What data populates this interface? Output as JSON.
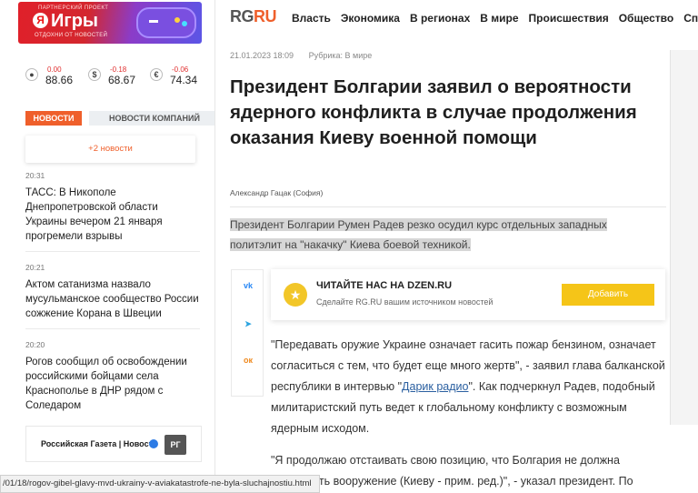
{
  "promo": {
    "tag": "ПАРТНЕРСКИЙ ПРОЕКТ",
    "ya": "Я",
    "title": "Игры",
    "subtitle": "ОТДОХНИ ОТ НОВОСТЕЙ"
  },
  "rates": [
    {
      "icon": "oil-drop-icon",
      "glyph": "●",
      "delta": "0.00",
      "value": "88.66"
    },
    {
      "icon": "dollar-icon",
      "glyph": "$",
      "delta": "-0.18",
      "value": "68.67"
    },
    {
      "icon": "euro-icon",
      "glyph": "€",
      "delta": "-0.06",
      "value": "74.34"
    }
  ],
  "tabs": {
    "active": "НОВОСТИ",
    "other": "НОВОСТИ КОМПАНИЙ"
  },
  "more_news": "+2 новости",
  "news": [
    {
      "time": "20:31",
      "title": "ТАСС: В Никополе Днепропетровской области Украины вечером 21 января прогремели взрывы"
    },
    {
      "time": "20:21",
      "title": "Актом сатанизма назвало мусульманское сообщество России сожжение Корана в Швеции"
    },
    {
      "time": "20:20",
      "title": "Рогов сообщил об освобождении российскими бойцами села Краснополье в ДНР рядом с Соледаром"
    }
  ],
  "rg_banner": {
    "text": "Российская Газета | Новости",
    "logo": "РГ"
  },
  "header": {
    "logo_rg": "RG",
    "logo_ru": "RU",
    "nav": [
      "Власть",
      "Экономика",
      "В регионах",
      "В мире",
      "Происшествия",
      "Общество",
      "Спорт"
    ]
  },
  "article": {
    "date": "21.01.2023 18:09",
    "rubric": "Рубрика: В мире",
    "headline": "Президент Болгарии заявил о вероятности ядерного конфликта в случае продолжения оказания Киеву военной помощи",
    "author": "Александр Гацак (София)",
    "lead": "Президент Болгарии Румен Радев резко осудил курс отдельных западных политэлит на \"накачку\" Киева боевой техникой.",
    "para1_a": "\"Передавать оружие Украине означает гасить пожар бензином, означает согласиться с тем, что будет еще много жертв\", - заявил глава балканской республики в интервью \"",
    "para1_link": "Дарик радио",
    "para1_b": "\". Как подчеркнул Радев, подобный милитаристский путь ведет к глобальному конфликту с возможным ядерным исходом.",
    "para2": "\"Я продолжаю отстаивать свою позицию, что Болгария не должна поставлять вооружение (Киеву - прим. ред.)\", - указал президент. По"
  },
  "dzen": {
    "heading": "ЧИТАЙТЕ НАС НА DZEN.RU",
    "subtitle": "Сделайте RG.RU вашим источником новостей",
    "button": "Добавить"
  },
  "share": {
    "vk": "vk",
    "tg": "➤",
    "ok": "ок"
  },
  "status_url": "/01/18/rogov-gibel-glavy-mvd-ukrainy-v-aviakatastrofe-ne-byla-sluchajnostiu.html",
  "colors": {
    "accent": "#ef5f2b",
    "button": "#f5c518"
  }
}
